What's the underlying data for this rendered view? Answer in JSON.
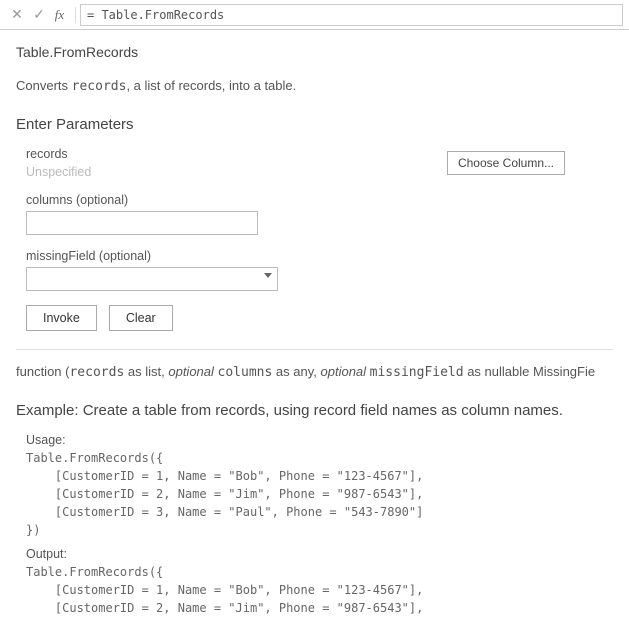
{
  "formula_bar": {
    "value": "= Table.FromRecords",
    "fx_label": "fx"
  },
  "fn": {
    "name": "Table.FromRecords",
    "desc_before": "Converts ",
    "desc_code": "records",
    "desc_after": ", a list of records, into a table."
  },
  "params_header": "Enter Parameters",
  "params": {
    "records": {
      "label": "records",
      "placeholder": "Unspecified"
    },
    "columns": {
      "label": "columns (optional)",
      "value": ""
    },
    "missingField": {
      "label": "missingField (optional)",
      "value": ""
    }
  },
  "choose_column_label": "Choose Column...",
  "actions": {
    "invoke": "Invoke",
    "clear": "Clear"
  },
  "signature": {
    "prefix": "function (",
    "p1_name": "records",
    "p1_as": " as list, ",
    "p2_opt": "optional ",
    "p2_name": "columns",
    "p2_as": " as any, ",
    "p3_opt": "optional ",
    "p3_name": "missingField",
    "p3_as": " as nullable MissingFie"
  },
  "example_header": "Example: Create a table from records, using record field names as column names.",
  "example": {
    "usage_label": "Usage:",
    "usage_code": "Table.FromRecords({\n    [CustomerID = 1, Name = \"Bob\", Phone = \"123-4567\"],\n    [CustomerID = 2, Name = \"Jim\", Phone = \"987-6543\"],\n    [CustomerID = 3, Name = \"Paul\", Phone = \"543-7890\"]\n})",
    "output_label": "Output:",
    "output_code": "Table.FromRecords({\n    [CustomerID = 1, Name = \"Bob\", Phone = \"123-4567\"],\n    [CustomerID = 2, Name = \"Jim\", Phone = \"987-6543\"],"
  }
}
